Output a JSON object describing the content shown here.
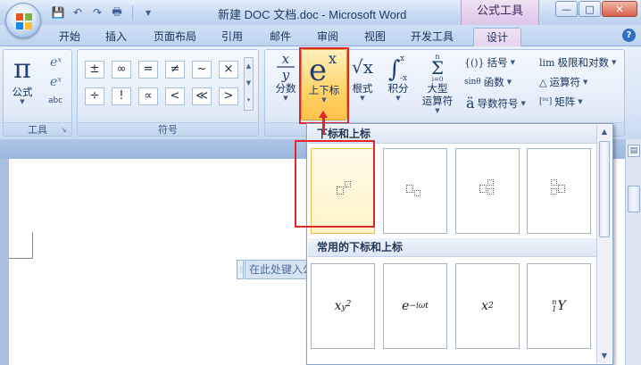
{
  "window": {
    "title": "新建 DOC 文档.doc - Microsoft Word",
    "context_tool_title": "公式工具",
    "controls": {
      "minimize": "—",
      "maximize": "□",
      "close": "✕"
    }
  },
  "quick_access": {
    "save": "💾",
    "undo": "↶",
    "redo": "↷",
    "print": "🖶",
    "more": "▾"
  },
  "tabs": [
    {
      "label": "开始"
    },
    {
      "label": "插入"
    },
    {
      "label": "页面布局"
    },
    {
      "label": "引用"
    },
    {
      "label": "邮件"
    },
    {
      "label": "审阅"
    },
    {
      "label": "视图"
    },
    {
      "label": "开发工具"
    },
    {
      "label": "设计"
    }
  ],
  "help": "?",
  "ribbon": {
    "tools_group": {
      "label": "工具",
      "equation_btn": {
        "glyph": "π",
        "label": "公式"
      },
      "launcher": "↘"
    },
    "symbols_group": {
      "label": "符号",
      "symbols": [
        "±",
        "∞",
        "=",
        "≠",
        "~",
        "×",
        "÷",
        "!",
        "∝",
        "<",
        "≪",
        ">"
      ]
    },
    "structures_group": {
      "fraction": {
        "label": "分数"
      },
      "script": {
        "label": "上下标"
      },
      "radical": {
        "glyph": "√x",
        "label": "根式"
      },
      "integral": {
        "label": "积分"
      },
      "large_op": {
        "label": "大型\n运算符"
      },
      "large_op_line1": "大型",
      "large_op_line2": "运算符",
      "bracket": {
        "glyph": "{()}",
        "label": "括号"
      },
      "function": {
        "glyph": "sinθ",
        "label": "函数"
      },
      "accent": {
        "glyph": "ä",
        "label": "导数符号"
      },
      "limit": {
        "glyph": "lim",
        "label": "极限和对数"
      },
      "operator": {
        "glyph": "△",
        "label": "运算符"
      },
      "matrix": {
        "glyph": "[⁰¹]",
        "label": "矩阵"
      }
    }
  },
  "document": {
    "placeholder": "在此处键入公式"
  },
  "gallery": {
    "section1_title": "下标和上标",
    "section2_title": "常用的下标和上标",
    "common": [
      "x_{y²}",
      "e^{−iωt}",
      "x²",
      "ⁿ₁Y"
    ]
  }
}
